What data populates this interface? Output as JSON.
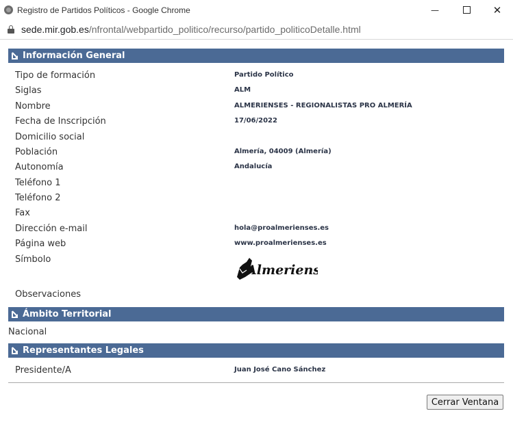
{
  "window": {
    "title": "Registro de Partidos Políticos - Google Chrome",
    "minimize_glyph": "—",
    "close_glyph": "✕"
  },
  "address": {
    "host": "sede.mir.gob.es",
    "path": "/nfrontal/webpartido_politico/recurso/partido_politicoDetalle.html"
  },
  "sections": {
    "general": "Información General",
    "ambito": "Ámbito Territorial",
    "representantes": "Representantes Legales"
  },
  "general": {
    "tipo_label": "Tipo de formación",
    "tipo_value": "Partido Político",
    "siglas_label": "Siglas",
    "siglas_value": "ALM",
    "nombre_label": "Nombre",
    "nombre_value": "ALMERIENSES - REGIONALISTAS PRO ALMERÍA",
    "fecha_label": "Fecha de Inscripción",
    "fecha_value": "17/06/2022",
    "domicilio_label": "Domicilio social",
    "poblacion_label": "Población",
    "poblacion_value": "Almería, 04009 (Almería)",
    "autonomia_label": "Autonomía",
    "autonomia_value": "Andalucía",
    "telefono1_label": "Teléfono 1",
    "telefono2_label": "Teléfono 2",
    "fax_label": "Fax",
    "email_label": "Dirección e-mail",
    "email_value": "hola@proalmerienses.es",
    "web_label": "Página web",
    "web_value": "www.proalmerienses.es",
    "simbolo_label": "Símbolo",
    "logo_text": "Almerienses",
    "observaciones_label": "Observaciones"
  },
  "ambito": {
    "value": "Nacional"
  },
  "representantes": {
    "cargo_label": "Presidente/A",
    "cargo_value": "Juan José Cano Sánchez"
  },
  "actions": {
    "close_label": "Cerrar Ventana"
  },
  "colors": {
    "section_header": "#4b6a95",
    "value_text": "#2b3447"
  }
}
